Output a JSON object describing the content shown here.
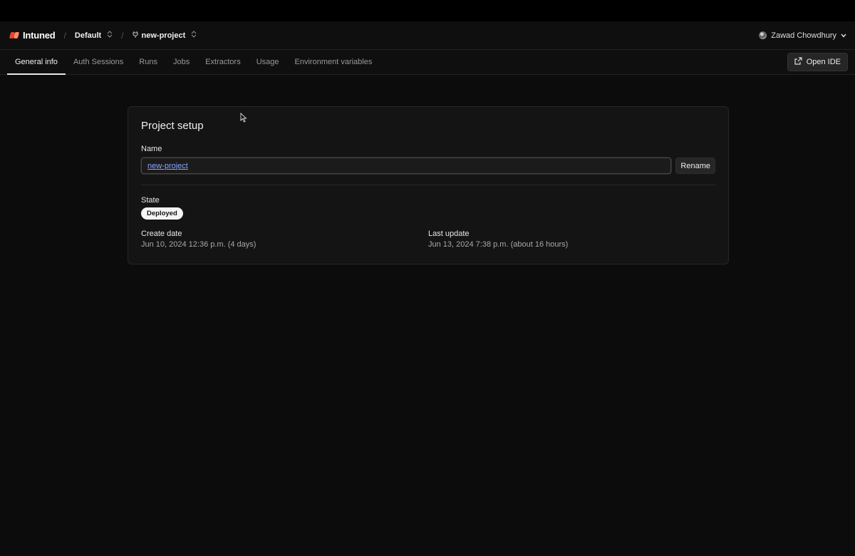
{
  "header": {
    "brand": "Intuned",
    "separator": "/",
    "workspace": "Default",
    "project": "new-project",
    "user": "Zawad Chowdhury"
  },
  "tabs": [
    {
      "label": "General info",
      "active": true
    },
    {
      "label": "Auth Sessions"
    },
    {
      "label": "Runs"
    },
    {
      "label": "Jobs"
    },
    {
      "label": "Extractors"
    },
    {
      "label": "Usage"
    },
    {
      "label": "Environment variables"
    }
  ],
  "toolbar": {
    "open_ide_label": "Open IDE"
  },
  "project_setup": {
    "title": "Project setup",
    "name_label": "Name",
    "name_value": "new-project",
    "rename_label": "Rename",
    "state_label": "State",
    "state_value": "Deployed",
    "create_date_label": "Create date",
    "create_date_value": "Jun 10, 2024 12:36 p.m. (4 days)",
    "last_update_label": "Last update",
    "last_update_value": "Jun 13, 2024 7:38 p.m. (about 16 hours)"
  },
  "colors": {
    "background": "#0c0c0c",
    "card": "#141414",
    "accent": "#e8452f",
    "badge_bg": "#f4f4f4"
  }
}
